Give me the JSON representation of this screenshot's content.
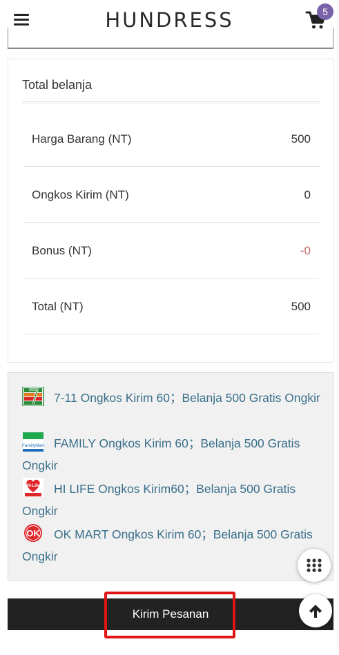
{
  "header": {
    "brand": "HUNDRESS",
    "cart_count": "5"
  },
  "summary": {
    "title": "Total belanja",
    "rows": [
      {
        "label": "Harga Barang (NT)",
        "value": "500"
      },
      {
        "label": "Ongkos Kirim (NT)",
        "value": "0"
      },
      {
        "label": "Bonus (NT)",
        "value": "-0"
      },
      {
        "label": "Total (NT)",
        "value": "500"
      }
    ]
  },
  "promo": {
    "items": [
      {
        "icon": "seven-eleven-logo-icon",
        "text": "7-11 Ongkos Kirim 60；Belanja 500 Gratis Ongkir"
      },
      {
        "icon": "familymart-logo-icon",
        "text": "FAMILY Ongkos Kirim 60；Belanja 500 Gratis Ongkir"
      },
      {
        "icon": "hilife-logo-icon",
        "text": "HI LIFE Ongkos Kirim60；Belanja 500 Gratis Ongkir"
      },
      {
        "icon": "okmart-logo-icon",
        "text": "OK MART Ongkos Kirim 60；Belanja 500 Gratis Ongkir"
      }
    ]
  },
  "submit": {
    "label": "Kirim Pesanan"
  },
  "colors": {
    "badge": "#7a62a8",
    "promo_text": "#3a6f8a",
    "negative_value": "#c66b6b",
    "button_bg": "#222222",
    "highlight": "#e01414"
  }
}
